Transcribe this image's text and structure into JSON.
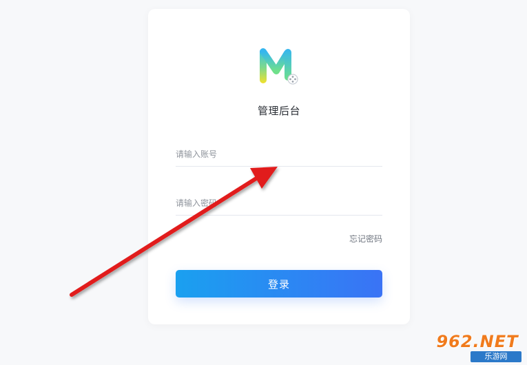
{
  "login": {
    "title": "管理后台",
    "account_placeholder": "请输入账号",
    "password_placeholder": "请输入密码",
    "forgot_password": "忘记密码",
    "login_button": "登录"
  },
  "watermark": {
    "brand": "962.NET",
    "sub": "乐游网"
  },
  "colors": {
    "button_start": "#1aa0f0",
    "button_end": "#3a73f5",
    "arrow": "#e11d1d"
  },
  "icons": {
    "logo": "brand-logo-icon"
  }
}
